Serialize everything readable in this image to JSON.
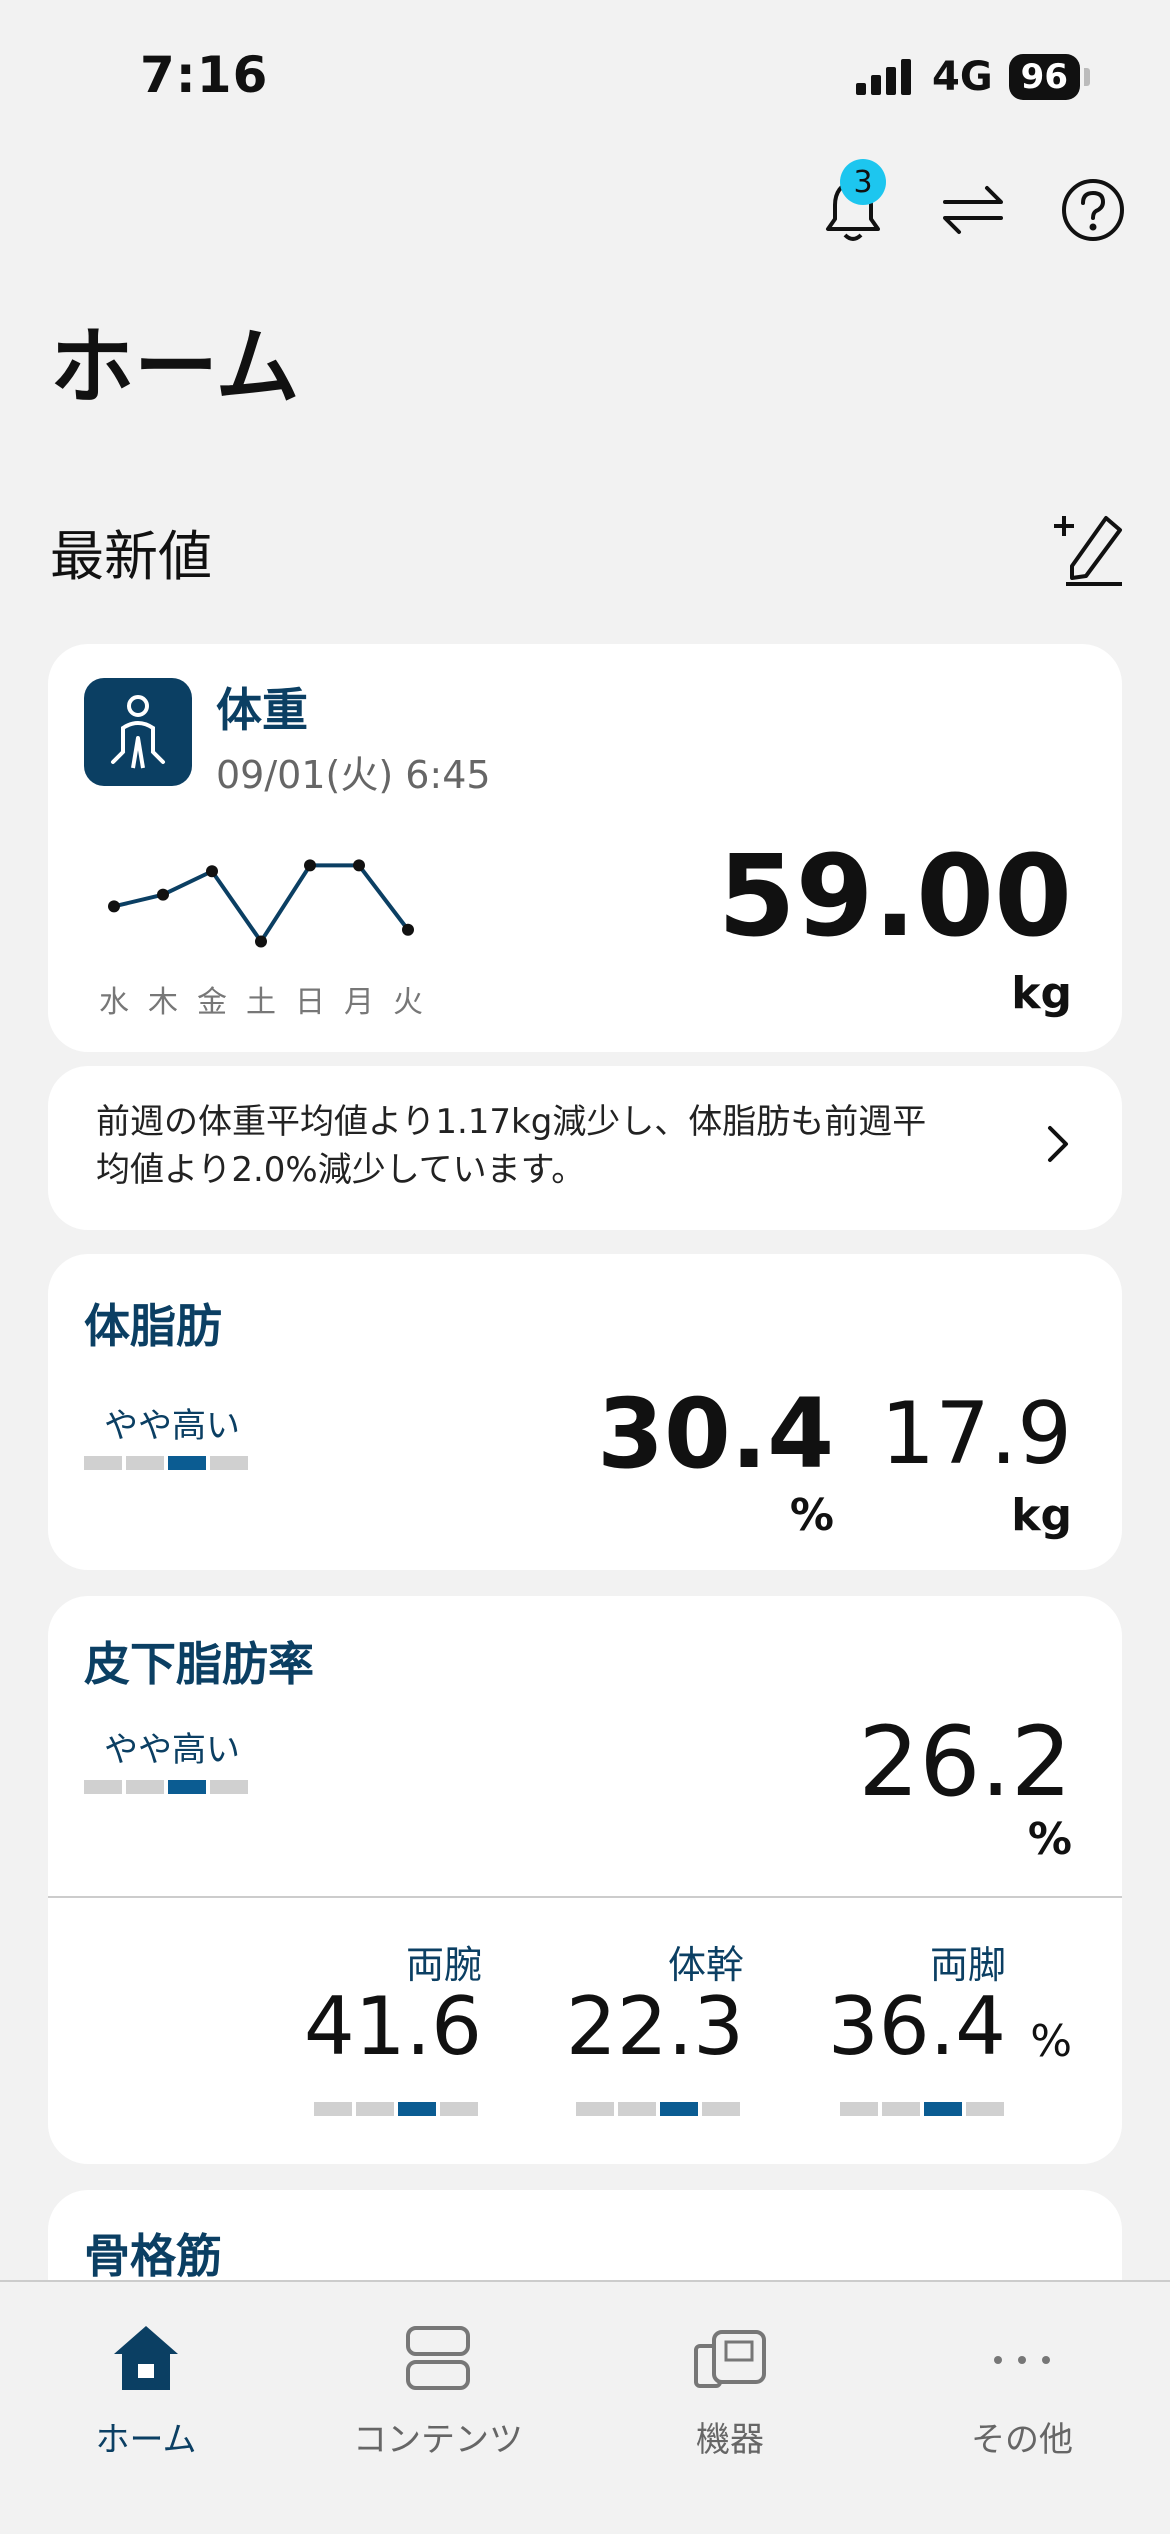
{
  "status": {
    "time": "7:16",
    "network": "4G",
    "battery": "96"
  },
  "header": {
    "notifications_count": "3",
    "title": "ホーム"
  },
  "section": {
    "title": "最新値"
  },
  "weight_card": {
    "title": "体重",
    "date": "09/01(火) 6:45",
    "value": "59.00",
    "unit": "kg",
    "chart_days": [
      "水",
      "木",
      "金",
      "土",
      "日",
      "月",
      "火"
    ]
  },
  "chart_data": {
    "type": "line",
    "categories": [
      "水",
      "木",
      "金",
      "土",
      "日",
      "月",
      "火"
    ],
    "values": [
      59.4,
      59.6,
      60.0,
      58.8,
      60.1,
      60.1,
      59.0
    ],
    "title": "",
    "xlabel": "",
    "ylabel": "",
    "ylim": [
      58.5,
      60.5
    ],
    "grid": false,
    "color": "#0b3f63"
  },
  "summary": {
    "line1": "前週の体重平均値より1.17kg減少し、体脂肪も前週平",
    "line2": "均値より2.0%減少しています。"
  },
  "body_fat_card": {
    "title": "体脂肪",
    "level_label": "やや高い",
    "level_position": 3,
    "level_total": 4,
    "percent_value": "30.4",
    "percent_unit": "%",
    "kg_value": "17.9",
    "kg_unit": "kg"
  },
  "subcutaneous_card": {
    "title": "皮下脂肪率",
    "level_label": "やや高い",
    "level_position": 3,
    "value": "26.2",
    "unit": "%",
    "segments": [
      {
        "label": "両腕",
        "value": "41.6",
        "level_position": 3
      },
      {
        "label": "体幹",
        "value": "22.3",
        "level_position": 3
      },
      {
        "label": "両脚",
        "value": "36.4",
        "level_position": 3
      }
    ],
    "segments_unit": "%"
  },
  "skeletal_card": {
    "title": "骨格筋"
  },
  "tabbar": {
    "items": [
      {
        "label": "ホーム",
        "icon": "home-icon"
      },
      {
        "label": "コンテンツ",
        "icon": "contents-icon"
      },
      {
        "label": "機器",
        "icon": "devices-icon"
      },
      {
        "label": "その他",
        "icon": "more-icon"
      }
    ]
  },
  "colors": {
    "accent": "#0b3f63",
    "badge": "#1dc6ef",
    "level_on": "#0b5c92",
    "background": "#f2f2f2"
  }
}
